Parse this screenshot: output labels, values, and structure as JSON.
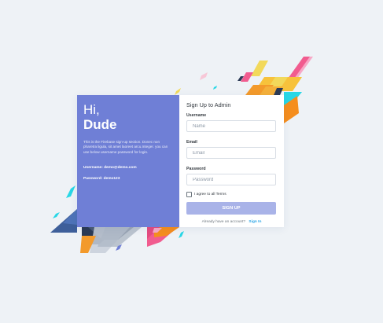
{
  "intro": {
    "greeting": "Hi,",
    "name": "Dude",
    "description": "This is the Firebase sign-up section. Donec non pharetra ligula, sit amet laoreet arcu.Integer. you can use below username password for login.",
    "username_line": "Username: demo@demo.com",
    "password_line": "Password: demo123"
  },
  "form": {
    "title": "Sign Up to Admin",
    "username_label": "Username",
    "username_placeholder": "Name",
    "email_label": "Email",
    "email_placeholder": "Email",
    "password_label": "Password",
    "password_placeholder": "Password",
    "terms_label": "I agree to all Terms",
    "submit_label": "SIGN UP",
    "account_text": "Already have an account?",
    "signin_link": "Sign In"
  },
  "colors": {
    "panel": "#6f7fd6",
    "button": "#a9b3e8",
    "link": "#2ba5e6"
  }
}
